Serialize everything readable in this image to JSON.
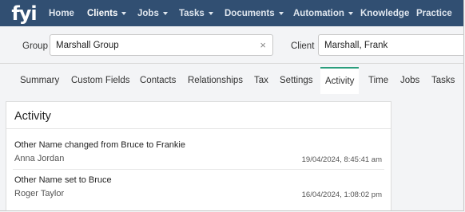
{
  "app": {
    "logo_text": "fyi"
  },
  "nav": {
    "items": [
      {
        "label": "Home",
        "dropdown": false,
        "active": false
      },
      {
        "label": "Clients",
        "dropdown": true,
        "active": true
      },
      {
        "label": "Jobs",
        "dropdown": true,
        "active": false
      },
      {
        "label": "Tasks",
        "dropdown": true,
        "active": false
      },
      {
        "label": "Documents",
        "dropdown": true,
        "active": false
      },
      {
        "label": "Automation",
        "dropdown": true,
        "active": false
      },
      {
        "label": "Knowledge",
        "dropdown": false,
        "active": false
      },
      {
        "label": "Practice",
        "dropdown": false,
        "active": false
      }
    ]
  },
  "selectors": {
    "group_label": "Group",
    "group_value": "Marshall Group",
    "group_clear": "×",
    "client_label": "Client",
    "client_value": "Marshall, Frank"
  },
  "tabs": [
    {
      "label": "Summary"
    },
    {
      "label": "Custom Fields"
    },
    {
      "label": "Contacts"
    },
    {
      "label": "Relationships"
    },
    {
      "label": "Tax"
    },
    {
      "label": "Settings"
    },
    {
      "label": "Activity",
      "active": true
    },
    {
      "label": "Time"
    },
    {
      "label": "Jobs"
    },
    {
      "label": "Tasks"
    }
  ],
  "activity": {
    "title": "Activity",
    "entries": [
      {
        "text": "Other Name changed from Bruce to Frankie",
        "user": "Anna Jordan",
        "timestamp": "19/04/2024, 8:45:41 am"
      },
      {
        "text": "Other Name set to Bruce",
        "user": "Roger Taylor",
        "timestamp": "16/04/2024, 1:08:02 pm"
      }
    ]
  },
  "colors": {
    "nav_bg": "#314f72",
    "active_tab_accent": "#2a9d7c"
  }
}
